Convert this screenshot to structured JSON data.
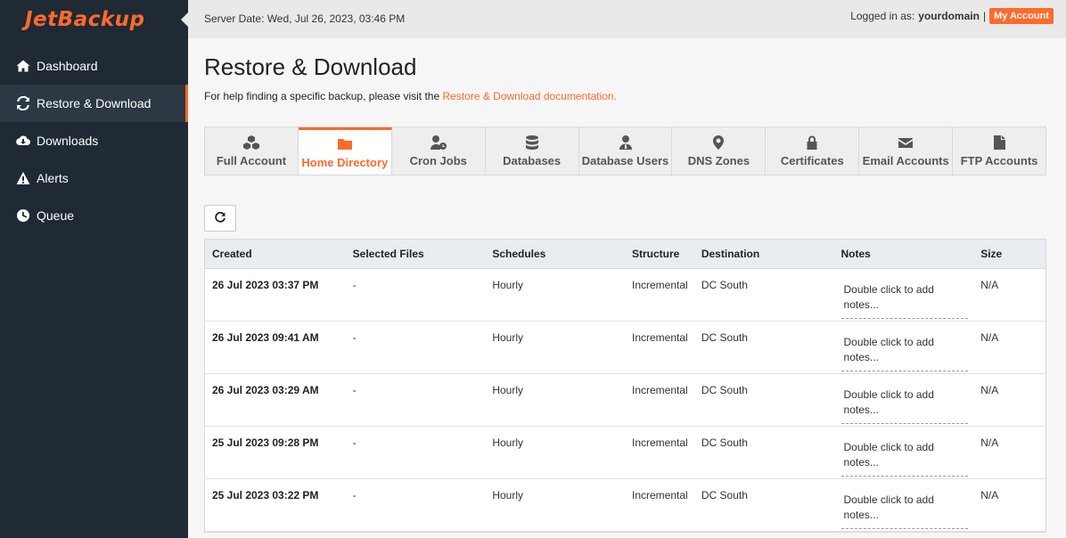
{
  "brand": {
    "logo_text": "JetBackup",
    "accent": "#ff6a2b"
  },
  "sidebar": {
    "items": [
      {
        "label": "Dashboard",
        "icon": "home-icon"
      },
      {
        "label": "Restore & Download",
        "icon": "refresh-icon",
        "active": true
      },
      {
        "label": "Downloads",
        "icon": "cloud-download-icon"
      },
      {
        "label": "Alerts",
        "icon": "warning-icon"
      },
      {
        "label": "Queue",
        "icon": "clock-icon"
      }
    ]
  },
  "topbar": {
    "server_date": "Server Date: Wed, Jul 26, 2023, 03:46 PM",
    "logged_in_prefix": "Logged in as:",
    "username": "yourdomain",
    "separator": "|",
    "my_account_label": "My Account"
  },
  "page": {
    "title": "Restore & Download",
    "help_text": "For help finding a specific backup, please visit the ",
    "help_link": "Restore & Download documentation."
  },
  "tabs": [
    {
      "label": "Full Account",
      "icon": "cubes-icon"
    },
    {
      "label": "Home Directory",
      "icon": "folder-icon",
      "active": true
    },
    {
      "label": "Cron Jobs",
      "icon": "user-clock-icon"
    },
    {
      "label": "Databases",
      "icon": "database-icon"
    },
    {
      "label": "Database Users",
      "icon": "user-tie-icon"
    },
    {
      "label": "DNS Zones",
      "icon": "map-marker-icon"
    },
    {
      "label": "Certificates",
      "icon": "lock-icon"
    },
    {
      "label": "Email Accounts",
      "icon": "envelope-icon"
    },
    {
      "label": "FTP Accounts",
      "icon": "file-icon"
    }
  ],
  "table": {
    "headers": {
      "created": "Created",
      "files": "Selected Files",
      "schedules": "Schedules",
      "structure": "Structure",
      "destination": "Destination",
      "notes": "Notes",
      "size": "Size"
    },
    "notes_placeholder": "Double click to add notes...",
    "rows": [
      {
        "created": "26 Jul 2023 03:37 PM",
        "files": "-",
        "schedules": "Hourly",
        "structure": "Incremental",
        "destination": "DC South",
        "size": "N/A"
      },
      {
        "created": "26 Jul 2023 09:41 AM",
        "files": "-",
        "schedules": "Hourly",
        "structure": "Incremental",
        "destination": "DC South",
        "size": "N/A"
      },
      {
        "created": "26 Jul 2023 03:29 AM",
        "files": "-",
        "schedules": "Hourly",
        "structure": "Incremental",
        "destination": "DC South",
        "size": "N/A"
      },
      {
        "created": "25 Jul 2023 09:28 PM",
        "files": "-",
        "schedules": "Hourly",
        "structure": "Incremental",
        "destination": "DC South",
        "size": "N/A"
      },
      {
        "created": "25 Jul 2023 03:22 PM",
        "files": "-",
        "schedules": "Hourly",
        "structure": "Incremental",
        "destination": "DC South",
        "size": "N/A"
      }
    ]
  }
}
